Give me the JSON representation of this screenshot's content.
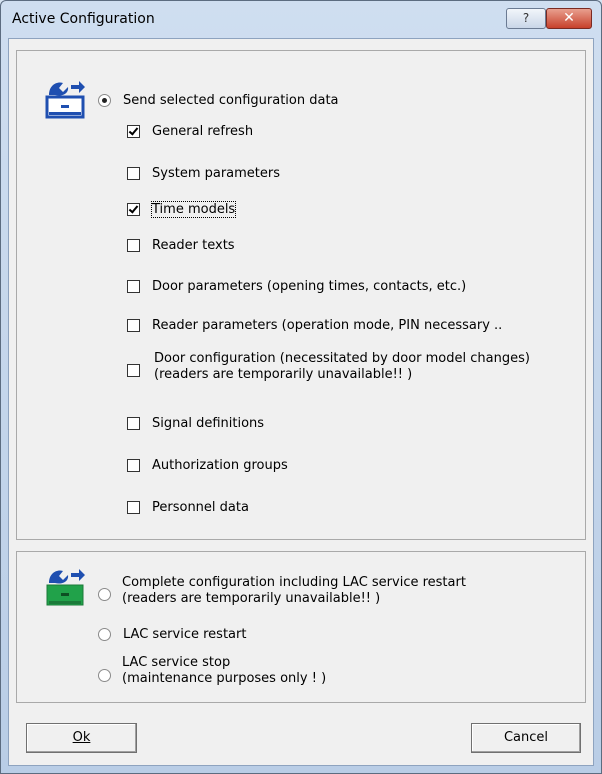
{
  "window": {
    "title": "Active Configuration",
    "help_label": "?",
    "close_label": "✕"
  },
  "send_group": {
    "radio_label": "Send selected configuration data",
    "items": [
      {
        "label": "General refresh",
        "checked": true
      },
      {
        "label": "System parameters",
        "checked": false
      },
      {
        "label": "Time models",
        "checked": true
      },
      {
        "label": "Reader texts",
        "checked": false
      },
      {
        "label": "Door parameters (opening times, contacts, etc.)",
        "checked": false
      },
      {
        "label": "Reader parameters (operation mode, PIN necessary ..",
        "checked": false
      },
      {
        "label": "Door configuration (necessitated by door model changes)",
        "label2": "(readers are temporarily unavailable!! )",
        "checked": false
      },
      {
        "label": "Signal definitions",
        "checked": false
      },
      {
        "label": "Authorization groups",
        "checked": false
      },
      {
        "label": "Personnel data",
        "checked": false
      }
    ]
  },
  "complete_group": {
    "complete_label": "Complete configuration including LAC service restart",
    "complete_label2": "(readers are temporarily unavailable!! )",
    "restart_label": "LAC service restart",
    "stop_label": "LAC service stop",
    "stop_label2": "(maintenance purposes only ! )"
  },
  "buttons": {
    "ok_label": "Ok",
    "cancel_label": "Cancel"
  },
  "colors": {
    "icon_blue": "#1f4fb0",
    "icon_green": "#21a24a"
  }
}
